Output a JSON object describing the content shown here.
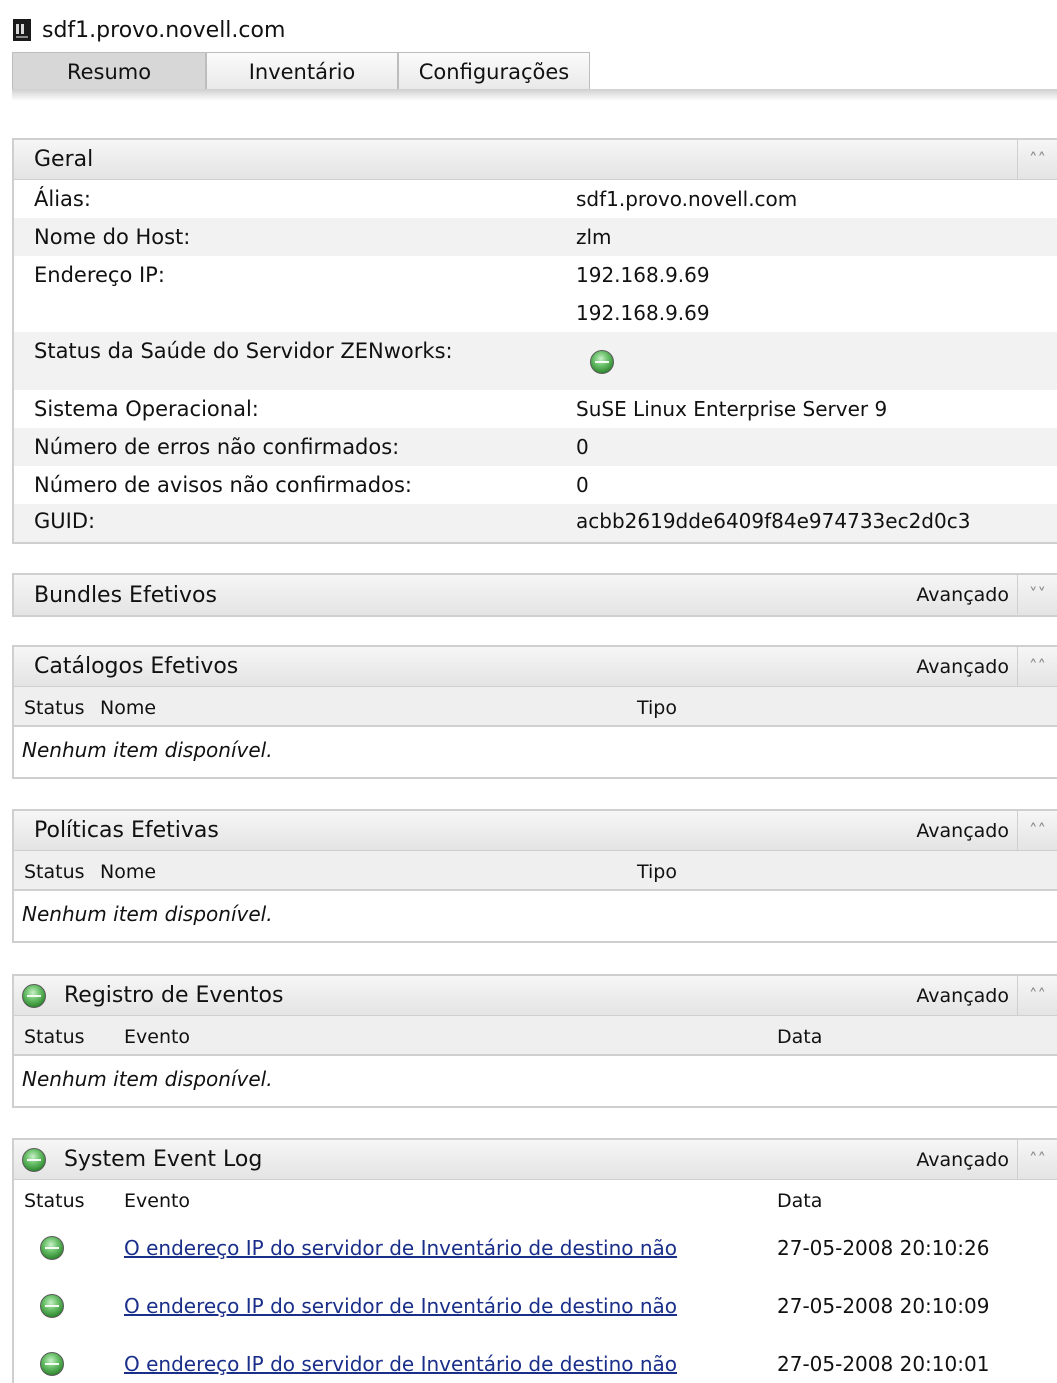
{
  "window": {
    "title": "sdf1.provo.novell.com"
  },
  "tabs": [
    {
      "label": "Resumo"
    },
    {
      "label": "Inventário"
    },
    {
      "label": "Configurações"
    }
  ],
  "geral": {
    "title": "Geral",
    "rows": {
      "alias": {
        "label": "Álias:",
        "value": "sdf1.provo.novell.com"
      },
      "hostname": {
        "label": "Nome do Host:",
        "value": "zlm"
      },
      "ip": {
        "label": "Endereço IP:",
        "value1": "192.168.9.69",
        "value2": "192.168.9.69"
      },
      "health": {
        "label": "Status da Saúde do Servidor ZENworks:",
        "status": "ok"
      },
      "os": {
        "label": "Sistema Operacional:",
        "value": "SuSE Linux Enterprise Server 9"
      },
      "errors": {
        "label": "Número de erros não confirmados:",
        "value": "0"
      },
      "warnings": {
        "label": "Número de avisos não confirmados:",
        "value": "0"
      },
      "guid": {
        "label": "GUID:",
        "value": "acbb2619dde6409f84e974733ec2d0c3"
      }
    }
  },
  "advanced_label": "Avançado",
  "empty_text": "Nenhum item disponível.",
  "bundles": {
    "title": "Bundles Efetivos"
  },
  "catalogs": {
    "title": "Catálogos Efetivos",
    "col_status": "Status",
    "col_name": "Nome",
    "col_type": "Tipo"
  },
  "policies": {
    "title": "Políticas Efetivas",
    "col_status": "Status",
    "col_name": "Nome",
    "col_type": "Tipo"
  },
  "event_log": {
    "title": "Registro de Eventos",
    "col_status": "Status",
    "col_event": "Evento",
    "col_date": "Data"
  },
  "system_log": {
    "title": "System Event Log",
    "col_status": "Status",
    "col_event": "Evento",
    "col_date": "Data",
    "rows": [
      {
        "event": "O endereço IP do servidor de Inventário de destino não",
        "date": "27-05-2008 20:10:26"
      },
      {
        "event": "O endereço IP do servidor de Inventário de destino não",
        "date": "27-05-2008 20:10:09"
      },
      {
        "event": "O endereço IP do servidor de Inventário de destino não",
        "date": "27-05-2008 20:10:01"
      }
    ]
  },
  "icons": {
    "server": "server-icon",
    "status_ok": "status-ok-icon",
    "collapse": "double-chevron-up-icon",
    "expand": "double-chevron-down-icon"
  },
  "colors": {
    "status_ok": "#3f9e3f",
    "link": "#1a2f8a",
    "header_bg": "#e9e9e9"
  }
}
